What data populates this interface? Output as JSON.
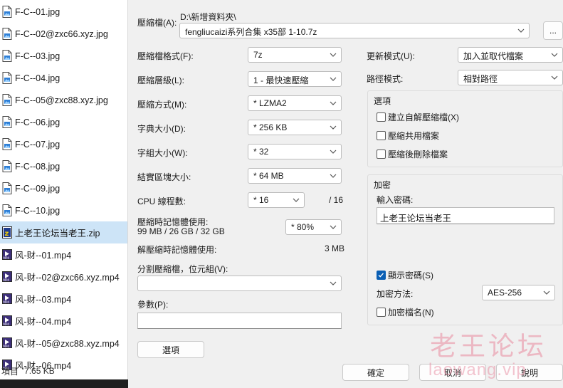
{
  "colors": {
    "accent": "#0a5fb4",
    "selection": "#cde4f7",
    "watermark": "#e98ba0"
  },
  "files": [
    {
      "name": "F-C--01.jpg",
      "icon": "jpg-file-icon"
    },
    {
      "name": "F-C--02@zxc66.xyz.jpg",
      "icon": "jpg-file-icon"
    },
    {
      "name": "F-C--03.jpg",
      "icon": "jpg-file-icon"
    },
    {
      "name": "F-C--04.jpg",
      "icon": "jpg-file-icon"
    },
    {
      "name": "F-C--05@zxc88.xyz.jpg",
      "icon": "jpg-file-icon"
    },
    {
      "name": "F-C--06.jpg",
      "icon": "jpg-file-icon"
    },
    {
      "name": "F-C--07.jpg",
      "icon": "jpg-file-icon"
    },
    {
      "name": "F-C--08.jpg",
      "icon": "jpg-file-icon"
    },
    {
      "name": "F-C--09.jpg",
      "icon": "jpg-file-icon"
    },
    {
      "name": "F-C--10.jpg",
      "icon": "jpg-file-icon"
    },
    {
      "name": "上老王论坛当老王.zip",
      "icon": "zip-file-icon",
      "selected": true
    },
    {
      "name": "风-财--01.mp4",
      "icon": "mp4-file-icon"
    },
    {
      "name": "风-财--02@zxc66.xyz.mp4",
      "icon": "mp4-file-icon"
    },
    {
      "name": "风-财--03.mp4",
      "icon": "mp4-file-icon"
    },
    {
      "name": "风-财--04.mp4",
      "icon": "mp4-file-icon"
    },
    {
      "name": "风-财--05@zxc88.xyz.mp4",
      "icon": "mp4-file-icon"
    },
    {
      "name": "风-财--06.mp4",
      "icon": "mp4-file-icon"
    }
  ],
  "status": {
    "label": "項目",
    "size": "7.65 KB"
  },
  "archive": {
    "label": "壓縮檔(A):",
    "path": "D:\\新增資料夾\\",
    "name": "fengliucaizi系列合集 x35部 1-10.7z",
    "browse": "..."
  },
  "left_options": {
    "format": {
      "label": "壓縮檔格式(F):",
      "value": "7z"
    },
    "level": {
      "label": "壓縮層級(L):",
      "value": "1 - 最快速壓縮"
    },
    "method": {
      "label": "壓縮方式(M):",
      "value": "*  LZMA2"
    },
    "dict": {
      "label": "字典大小(D):",
      "value": "*  256 KB"
    },
    "word": {
      "label": "字組大小(W):",
      "value": "*  32"
    },
    "solid": {
      "label": "結實區塊大小:",
      "value": "*  64 MB"
    },
    "cpu": {
      "label": "CPU 線程數:",
      "value": "*  16",
      "total": "/ 16"
    },
    "mem_comp": {
      "label": "壓縮時記憶體使用:",
      "detail": "99 MB / 26 GB / 32 GB",
      "value": "* 80%"
    },
    "mem_decomp": {
      "label": "解壓縮時記憶體使用:",
      "value": "3 MB"
    },
    "split": {
      "label": "分割壓縮檔，位元組(V):",
      "value": ""
    },
    "params": {
      "label": "參數(P):",
      "value": ""
    },
    "options_button": "選項"
  },
  "right_options": {
    "update": {
      "label": "更新模式(U):",
      "value": "加入並取代檔案"
    },
    "path": {
      "label": "路徑模式:",
      "value": "相對路徑"
    },
    "options_group": {
      "title": "選項",
      "sfx": {
        "label": "建立自解壓縮檔(X)",
        "checked": false
      },
      "shared": {
        "label": "壓縮共用檔案",
        "checked": false
      },
      "delete": {
        "label": "壓縮後刪除檔案",
        "checked": false
      }
    },
    "encryption": {
      "title": "加密",
      "password_label": "輸入密碼:",
      "password": "上老王论坛当老王",
      "show_password": {
        "label": "顯示密碼(S)",
        "checked": true
      },
      "method_label": "加密方法:",
      "method": "AES-256",
      "encrypt_names": {
        "label": "加密檔名(N)",
        "checked": false
      }
    }
  },
  "buttons": {
    "ok": "確定",
    "cancel": "取消",
    "help": "說明"
  },
  "watermark": {
    "title": "老王论坛",
    "url": "laowang.vip"
  }
}
